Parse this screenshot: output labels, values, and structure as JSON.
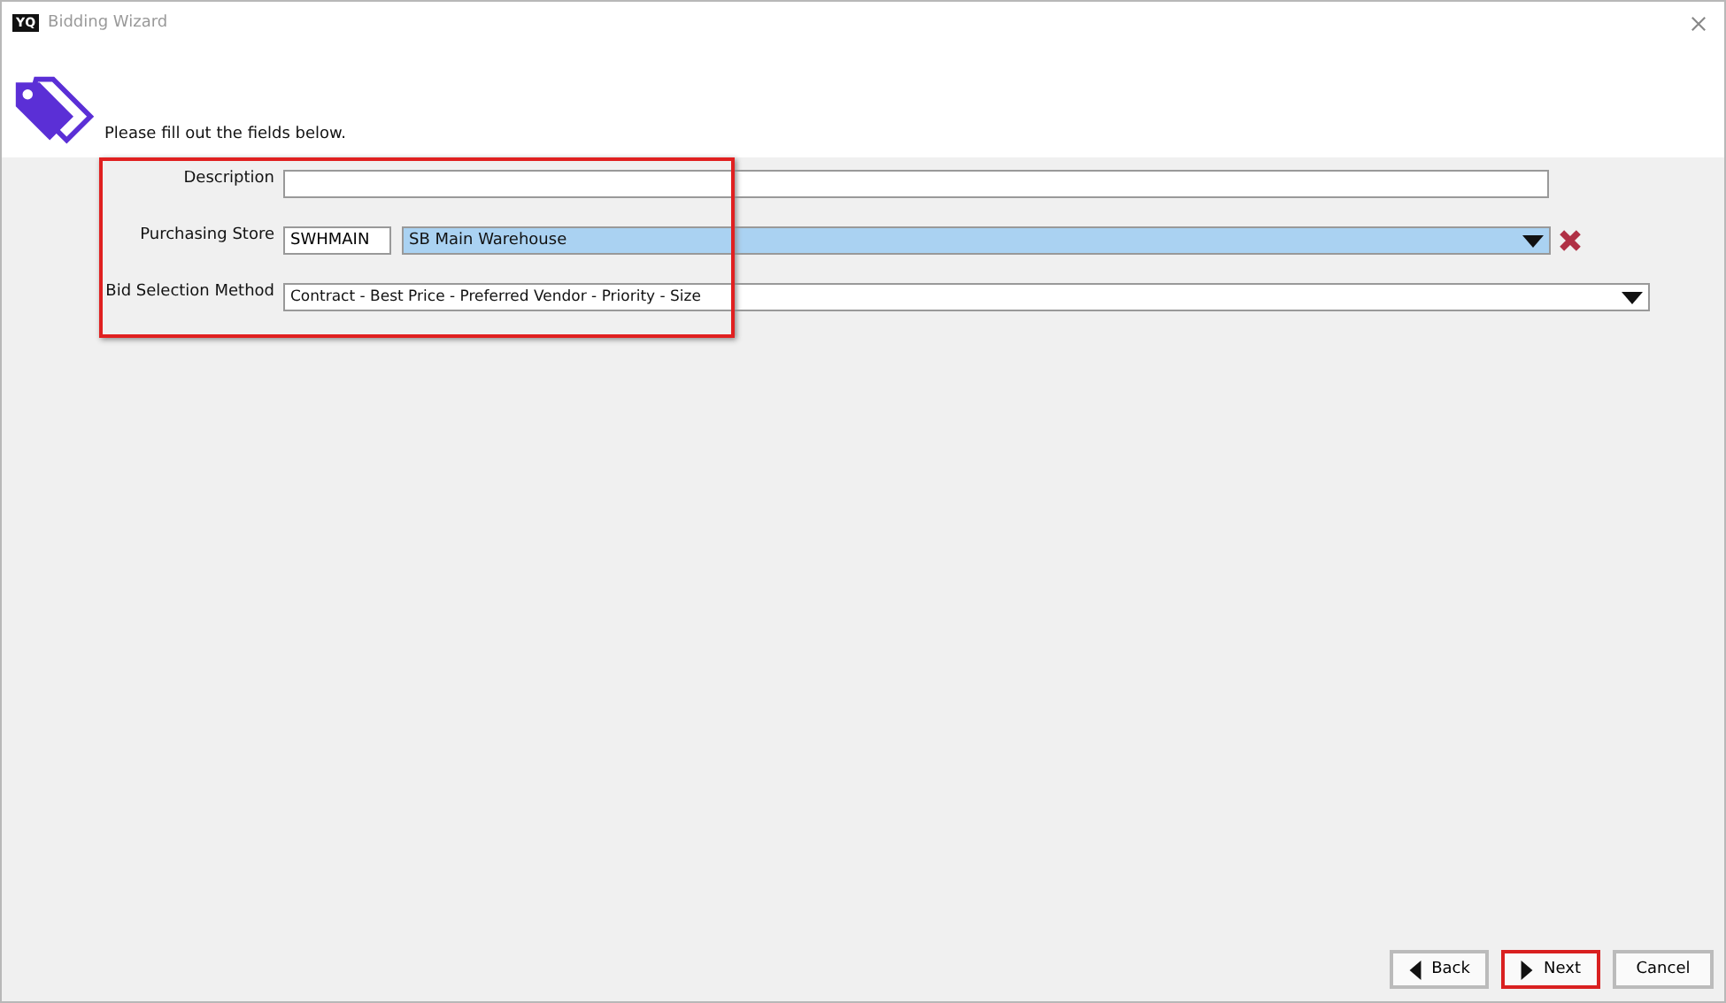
{
  "window": {
    "title": "Bidding Wizard",
    "logo": "YQ"
  },
  "header": {
    "instruction": "Please fill out the fields below."
  },
  "form": {
    "highlighted": true,
    "description": {
      "label": "Description"
    },
    "purchasing_store": {
      "label": "Purchasing Store",
      "code": "SWHMAIN",
      "store": "SB Main Warehouse"
    },
    "bid_selection_method": {
      "label": "Bid Selection Method",
      "value": "Contract - Best Price - Preferred Vendor - Priority - Size"
    }
  },
  "buttons": [
    {
      "kind": "back",
      "label": "Back",
      "highlighted": false
    },
    {
      "kind": "next",
      "label": "Next",
      "highlighted": true
    },
    {
      "kind": "plain",
      "label": "Cancel",
      "highlighted": false
    }
  ]
}
